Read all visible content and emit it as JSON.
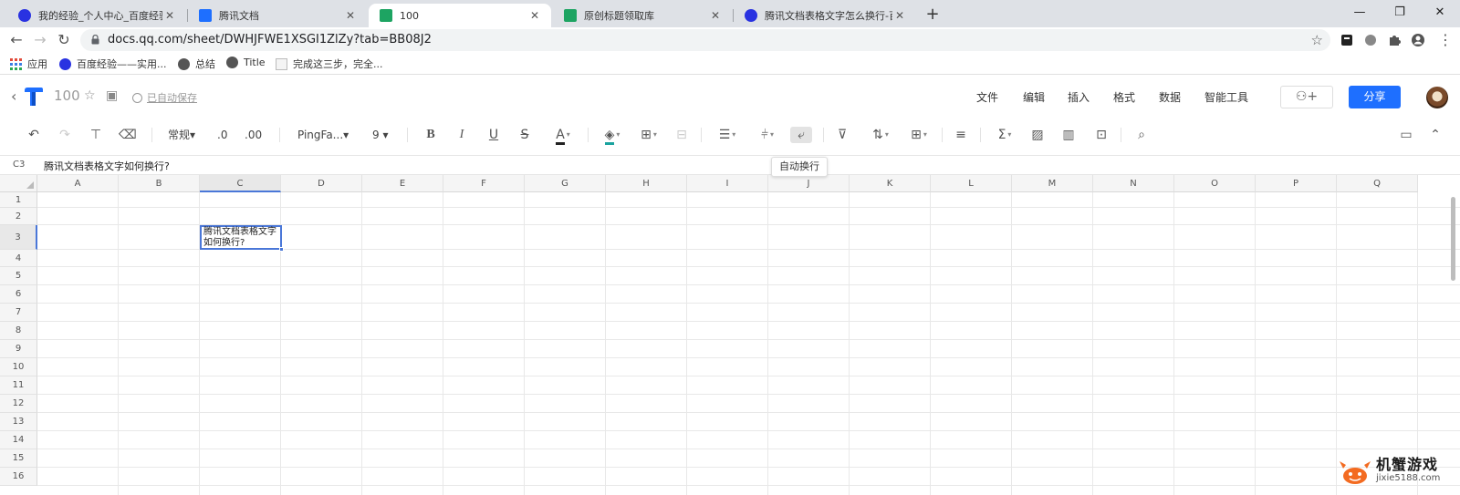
{
  "browser": {
    "tabs": [
      {
        "label": "我的经验_个人中心_百度经验",
        "icon": "baidu-icon",
        "active": false
      },
      {
        "label": "腾讯文档",
        "icon": "tencent-docs-icon",
        "active": false
      },
      {
        "label": "100",
        "icon": "sheet-icon",
        "active": true
      },
      {
        "label": "原创标题领取库",
        "icon": "sheet-icon",
        "active": false
      },
      {
        "label": "腾讯文档表格文字怎么换行-百度",
        "icon": "baidu-icon",
        "active": false
      }
    ],
    "close_glyph": "✕",
    "new_tab_glyph": "+",
    "url": "docs.qq.com/sheet/DWHJFWE1XSGI1ZlZy?tab=BB08J2",
    "bookmarks": [
      "应用",
      "百度经验——实用...",
      "总结",
      "Title",
      "完成这三步，完全..."
    ]
  },
  "doc": {
    "title": "100",
    "saved_status": "已自动保存",
    "menu": [
      "文件",
      "编辑",
      "插入",
      "格式",
      "数据",
      "智能工具"
    ],
    "share_label": "分享",
    "accent_color": "#1e6fff"
  },
  "toolbar": {
    "number_format": "常规",
    "decimal_decrease": ".0",
    "decimal_increase": ".00",
    "font_family": "PingFa...",
    "font_size": "9",
    "tooltip": "自动换行"
  },
  "formula_bar": {
    "cell_ref": "C3",
    "value": "腾讯文档表格文字如何换行?"
  },
  "sheet": {
    "columns": [
      "A",
      "B",
      "C",
      "D",
      "E",
      "F",
      "G",
      "H",
      "I",
      "J",
      "K",
      "L",
      "M",
      "N",
      "O",
      "P",
      "Q"
    ],
    "rows": [
      "1",
      "2",
      "3",
      "4",
      "5",
      "6",
      "7",
      "8",
      "9",
      "10",
      "11",
      "12",
      "13",
      "14",
      "15",
      "16"
    ],
    "selected_cell": "C3",
    "cell_c3_text": "腾讯文档表格文字如何换行?",
    "selection_color": "#4a77d8"
  },
  "watermark": {
    "name": "机蟹游戏",
    "site": "jixie5188.com"
  }
}
